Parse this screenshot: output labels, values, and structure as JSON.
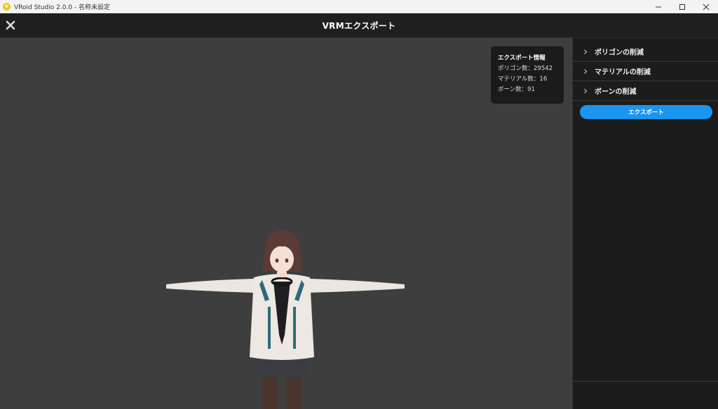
{
  "window": {
    "title": "VRoid Studio 2.0.0 - 名称未設定",
    "logo_letter": "V"
  },
  "header": {
    "title": "VRMエクスポート"
  },
  "export_info": {
    "title": "エクスポート情報",
    "polygon_count": "ポリゴン数：29542",
    "material_count": "マテリアル数：16",
    "bone_count": "ボーン数：91"
  },
  "sidebar": {
    "items": [
      {
        "label": "ポリゴンの削減"
      },
      {
        "label": "マテリアルの削減"
      },
      {
        "label": "ボーンの削減"
      }
    ],
    "export_button": "エクスポート"
  },
  "colors": {
    "accent": "#1a95f0",
    "viewport_bg": "#3e3e3e",
    "panel_bg": "#1c1c1c"
  }
}
